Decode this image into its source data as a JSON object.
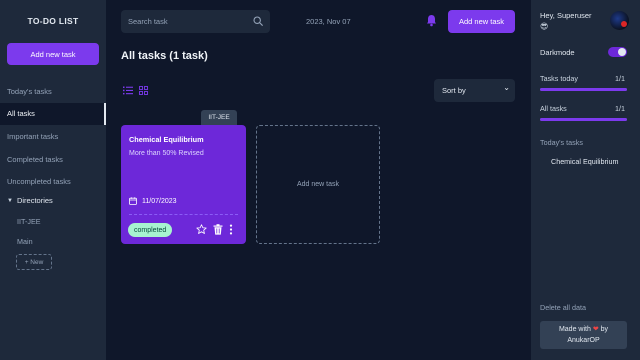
{
  "sidebar": {
    "app_title": "TO-DO LIST",
    "add_task_label": "Add new task",
    "nav": [
      {
        "label": "Today's tasks"
      },
      {
        "label": "All tasks",
        "active": true
      },
      {
        "label": "Important tasks"
      },
      {
        "label": "Completed tasks"
      },
      {
        "label": "Uncompleted tasks"
      }
    ],
    "directories_label": "Directories",
    "directories": [
      "IIT-JEE",
      "Main"
    ],
    "new_directory_label": "+ New"
  },
  "header": {
    "search_placeholder": "Search task",
    "date": "2023, Nov 07",
    "add_task_label": "Add new task"
  },
  "main": {
    "title": "All tasks (1 task)",
    "sort_label": "Sort by",
    "tasks": [
      {
        "directory": "IIT-JEE",
        "title": "Chemical Equilibrium",
        "description": "More than 50% Revised",
        "date": "11/07/2023",
        "status": "completed"
      }
    ],
    "add_card_label": "Add new task"
  },
  "right_sidebar": {
    "greeting": "Hey, Superuser",
    "emoji": "😎",
    "darkmode_label": "Darkmode",
    "darkmode_on": true,
    "stats": [
      {
        "label": "Tasks today",
        "count": "1/1",
        "progress": 1.0
      },
      {
        "label": "All tasks",
        "count": "1/1",
        "progress": 1.0
      }
    ],
    "today_tasks_label": "Today's tasks",
    "today_tasks": [
      "Chemical Equilibrium"
    ],
    "delete_all_label": "Delete all data",
    "footer_made_with": "Made with",
    "footer_by": "by",
    "footer_author": "AnukarOP"
  },
  "colors": {
    "accent": "#7c3aed",
    "card": "#6d28d9",
    "background": "#0f172a",
    "panel": "#1e293b",
    "badge": "#a7f3d0"
  },
  "icons": [
    "search-icon",
    "bell-icon",
    "list-view-icon",
    "grid-view-icon",
    "calendar-icon",
    "star-icon",
    "trash-icon",
    "more-options-icon",
    "chevron-down-icon",
    "heart-icon"
  ]
}
